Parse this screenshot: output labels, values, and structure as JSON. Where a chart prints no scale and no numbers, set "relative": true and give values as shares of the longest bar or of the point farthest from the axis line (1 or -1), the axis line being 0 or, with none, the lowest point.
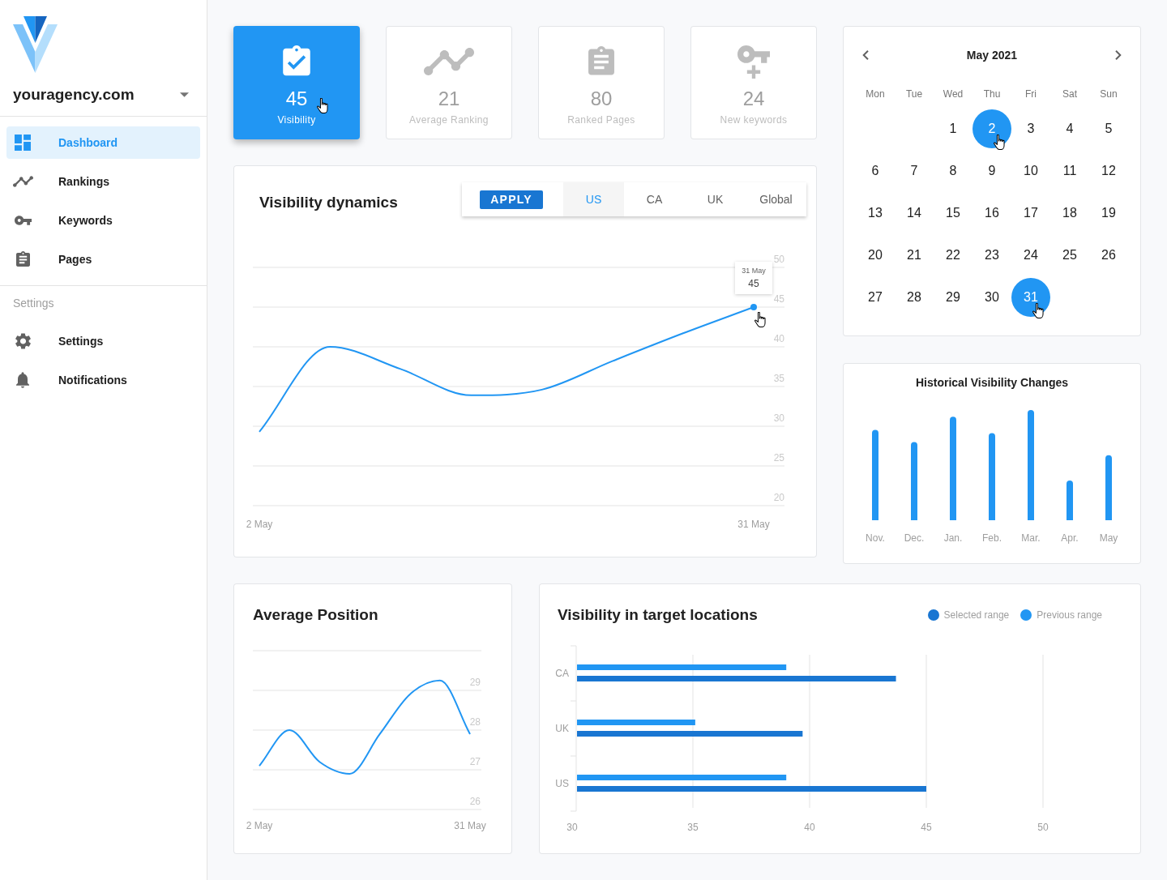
{
  "sidebar": {
    "domain": "youragency.com",
    "nav": [
      {
        "label": "Dashboard",
        "selected": true
      },
      {
        "label": "Rankings",
        "selected": false
      },
      {
        "label": "Keywords",
        "selected": false
      },
      {
        "label": "Pages",
        "selected": false
      }
    ],
    "section_title": "Settings",
    "settings_nav": [
      {
        "label": "Settings",
        "selected": false
      },
      {
        "label": "Notifications",
        "selected": false
      }
    ]
  },
  "stat_cards": [
    {
      "value": "45",
      "label": "Visibility",
      "selected": true,
      "hovered": true
    },
    {
      "value": "21",
      "label": "Average Ranking",
      "selected": false,
      "hovered": false
    },
    {
      "value": "80",
      "label": "Ranked Pages",
      "selected": false,
      "hovered": false
    },
    {
      "value": "24",
      "label": "New keywords",
      "selected": false,
      "hovered": false
    }
  ],
  "visibility_dynamics": {
    "title": "Visibility dynamics",
    "apply_button": "APPLY",
    "tabs": [
      {
        "label": "US",
        "selected": true
      },
      {
        "label": "CA",
        "selected": false
      },
      {
        "label": "UK",
        "selected": false
      },
      {
        "label": "Global",
        "selected": false
      }
    ],
    "chart_data": {
      "type": "line",
      "categories": [
        "2 May",
        null,
        null,
        null,
        null,
        null,
        null,
        "31 May"
      ],
      "values": [
        29.3,
        40,
        37.2,
        33.9,
        34.6,
        38.2,
        41.7,
        45
      ],
      "ylim": [
        20,
        50
      ],
      "yticks": [
        20,
        25,
        30,
        35,
        40,
        45,
        50
      ],
      "grid": true
    },
    "tooltip": {
      "title": "31 May",
      "value": "45",
      "hovered": true
    }
  },
  "calendar": {
    "month": "May 2021",
    "weekdays": [
      "Mon",
      "Tue",
      "Wed",
      "Thu",
      "Fri",
      "Sat",
      "Sun"
    ],
    "weeks": [
      [
        {
          "label": "1",
          "selected": false,
          "hovered": false
        },
        {
          "label": "2",
          "selected": true,
          "hovered": true
        },
        {
          "label": "3",
          "selected": false,
          "hovered": false
        },
        {
          "label": "4",
          "selected": false,
          "hovered": false
        },
        {
          "label": "5",
          "selected": false,
          "hovered": false
        }
      ],
      [
        {
          "label": "6",
          "selected": false,
          "hovered": false
        },
        {
          "label": "7",
          "selected": false,
          "hovered": false
        },
        {
          "label": "8",
          "selected": false,
          "hovered": false
        },
        {
          "label": "9",
          "selected": false,
          "hovered": false
        },
        {
          "label": "10",
          "selected": false,
          "hovered": false
        },
        {
          "label": "11",
          "selected": false,
          "hovered": false
        },
        {
          "label": "12",
          "selected": false,
          "hovered": false
        }
      ],
      [
        {
          "label": "13",
          "selected": false,
          "hovered": false
        },
        {
          "label": "14",
          "selected": false,
          "hovered": false
        },
        {
          "label": "15",
          "selected": false,
          "hovered": false
        },
        {
          "label": "16",
          "selected": false,
          "hovered": false
        },
        {
          "label": "17",
          "selected": false,
          "hovered": false
        },
        {
          "label": "18",
          "selected": false,
          "hovered": false
        },
        {
          "label": "19",
          "selected": false,
          "hovered": false
        }
      ],
      [
        {
          "label": "20",
          "selected": false,
          "hovered": false
        },
        {
          "label": "21",
          "selected": false,
          "hovered": false
        },
        {
          "label": "22",
          "selected": false,
          "hovered": false
        },
        {
          "label": "23",
          "selected": false,
          "hovered": false
        },
        {
          "label": "24",
          "selected": false,
          "hovered": false
        },
        {
          "label": "25",
          "selected": false,
          "hovered": false
        },
        {
          "label": "26",
          "selected": false,
          "hovered": false
        }
      ],
      [
        {
          "label": "27",
          "selected": false,
          "hovered": false
        },
        {
          "label": "28",
          "selected": false,
          "hovered": false
        },
        {
          "label": "29",
          "selected": false,
          "hovered": false
        },
        {
          "label": "30",
          "selected": false,
          "hovered": false
        },
        {
          "label": "31",
          "selected": true,
          "hovered": true
        }
      ]
    ]
  },
  "historical_visibility": {
    "title": "Historical Visibility Changes",
    "chart_data": {
      "type": "bar",
      "categories": [
        "Nov.",
        "Dec.",
        "Jan.",
        "Feb.",
        "Mar.",
        "Apr.",
        "May"
      ],
      "values": [
        0.82,
        0.71,
        0.94,
        0.79,
        1,
        0.36,
        0.59
      ],
      "relative": true
    }
  },
  "average_position": {
    "title": "Average Position",
    "chart_data": {
      "type": "line",
      "categories": [
        "2 May",
        null,
        null,
        null,
        null,
        null,
        null,
        "31 May"
      ],
      "values": [
        27.1,
        28.0,
        27.2,
        26.9,
        27.9,
        28.9,
        29.25,
        27.9
      ],
      "ylim": [
        26,
        30
      ],
      "yticks": [
        26,
        27,
        28,
        29
      ],
      "grid": true
    }
  },
  "target_locations": {
    "title": "Visibility in target locations",
    "chart_data": {
      "type": "bar",
      "orientation": "horizontal",
      "categories": [
        "CA",
        "UK",
        "US"
      ],
      "series": [
        {
          "name": "Selected range",
          "color": "#1976d2",
          "values": [
            43.7,
            39.7,
            45
          ]
        },
        {
          "name": "Previous range",
          "color": "#2196f3",
          "values": [
            39,
            35.1,
            39
          ]
        }
      ],
      "xlim": [
        30,
        50
      ],
      "xticks": [
        30,
        35,
        40,
        45,
        50
      ],
      "grid": true
    }
  }
}
